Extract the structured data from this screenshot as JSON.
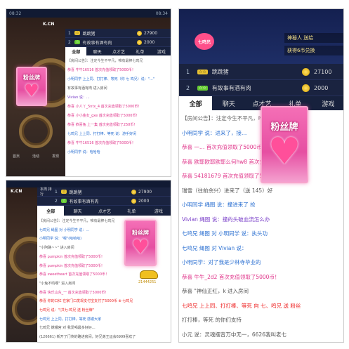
{
  "panel1": {
    "status_left": "08:32",
    "status_right": "08:34",
    "logo": "K.CN",
    "rank_header": "本周 排行",
    "rank": [
      {
        "num": "1",
        "name": "跳跳猪",
        "score": "27900"
      },
      {
        "num": "2",
        "name": "有故事有酒有肉",
        "score": "2000"
      }
    ],
    "tabs": [
      "全部",
      "聊天",
      "点才艺",
      "礼单",
      "游戏"
    ],
    "lines": [
      "【房间公告】：注定今生不平凡，唯有最棒七鸣兄",
      "恭喜 牛牛16516 首次充值领取了5000币！",
      "小明同学 上上同、打打棒、等死（你 七 鸣兄）说：\"...\"",
      "有故事有酒有肉 进入房间",
      "Vivian 说：...",
      "恭喜 小人丫_5ntx_4 首次充值领取了5000币！",
      "恭喜 小小金女_gxe 首次充值领取了5000币！",
      "恭喜 恭喜兔 上一集 首次充值领取了250币！",
      "七鸣兄 上上同、打打棒、等死 说：游手好闲",
      "恭喜 牛牛16516 首次充值领取了5000币！",
      "小明同学 说：哈哈哈"
    ],
    "card_title": "粉丝牌",
    "heart_glyph": "♥",
    "side_tabs": [
      "首页",
      "活动",
      "发现"
    ]
  },
  "panel2": {
    "badge": "七鸣兄",
    "marquee": "神秘人 送给",
    "marquee2": "获得6币兑换",
    "rank": [
      {
        "num": "1",
        "name": "跳跳猪",
        "score": "27100"
      },
      {
        "num": "2",
        "name": "有故事有酒有肉",
        "score": "2000"
      }
    ],
    "tabs": [
      "全部",
      "聊天",
      "点才艺",
      "礼单",
      "游戏"
    ],
    "lines": [
      {
        "text": "【房间公告】：注定今生不平凡，唯有最",
        "cls": "sys"
      },
      {
        "text": "小明同学 说：进来了，接…",
        "cls": "blue"
      },
      {
        "text": "恭喜 一…  首次充值领取了5000币！",
        "cls": "pink"
      },
      {
        "text": "恭喜 欧耶欧耶欧耶么何hw8 首次充值领取了5000币！",
        "cls": "pink"
      },
      {
        "text": "恭喜 54181679 首次充值领取了5000币！",
        "cls": "pink"
      },
      {
        "text": "瑞雪（往前余兴）进来了（送 145）好",
        "cls": "gray"
      },
      {
        "text": "小明同学 绳图 说：撞进来了 抢",
        "cls": "blue"
      },
      {
        "text": "Vivian 绳图 说：撞的头破血流怎么办",
        "cls": "purple"
      },
      {
        "text": "七鸣兄 绳图 对 小明同学 说：执头功",
        "cls": "blue"
      },
      {
        "text": "七鸣兄 绳图 对 Vivian 说：",
        "cls": "blue"
      },
      {
        "text": "小明同学：对了我是少林寺毕业的",
        "cls": "blue"
      },
      {
        "text": "恭喜 牛牛_2d2 首次充值领取了5000币！",
        "cls": "pink"
      },
      {
        "text": "恭喜 \"神仙正红，k 进入房间",
        "cls": "gray"
      },
      {
        "text": "七鸣兄 上上同、打打棒、等死 向 七、鸣兄 送 粉丝",
        "cls": "red"
      },
      {
        "text": "打打棒，等死 的你们支持",
        "cls": "gray"
      },
      {
        "text": "小元 说：灵魂摆音万中无一，6626我叫老七",
        "cls": "gray"
      }
    ],
    "card_title": "粉丝牌",
    "heart_glyph": "♥"
  },
  "panel3": {
    "logo": "K.CN",
    "rank_header": "本周 排行",
    "rank": [
      {
        "num": "1",
        "name": "跳跳猪",
        "score": "27900"
      },
      {
        "num": "2",
        "name": "有故事有酒有肉",
        "score": "2000"
      }
    ],
    "tabs": [
      "全部",
      "聊天",
      "点才艺",
      "礼单",
      "游戏"
    ],
    "lines": [
      {
        "text": "【房间公告】：注定今生不平凡，唯有最棒七鸣兄",
        "cls": "sys"
      },
      {
        "text": "七鸣兄 绳图 对 小明同学 说：…",
        "cls": "blue"
      },
      {
        "text": "小明同学 说：\"嗯\"(哈哈哈)",
        "cls": "blue"
      },
      {
        "text": "\"小阿路~~\" 进入房间",
        "cls": "gray"
      },
      {
        "text": "恭喜 pumpkin 首次充值领取了5000币！",
        "cls": "pink"
      },
      {
        "text": "恭喜 pumpkin 首次充值领取了5000币！",
        "cls": "pink"
      },
      {
        "text": "恭喜 sweetheart 首次充值领取了5000币！",
        "cls": "pink"
      },
      {
        "text": "\"小兔不鸣嘤\" 进入房间",
        "cls": "gray"
      },
      {
        "text": "恭喜 快乐山东_一 首次充值领取了5000币！",
        "cls": "pink"
      },
      {
        "text": "恭喜 你的口红 在家门口发现支付宝支付了5000币 ⊕ 七鸣兄",
        "cls": "red"
      },
      {
        "text": "七鸣兄 说：\"(共七·鸣兄 送 粉丝牌\"",
        "cls": "red"
      },
      {
        "text": "七鸣兄 上上同，打打棒，等死 感谢大家",
        "cls": "blue"
      },
      {
        "text": "七鸣兄 嫦娥宫 对 我爱喝最多好好…",
        "cls": "gray"
      },
      {
        "text": "(126661) 新开了门传的路进房间，好兄弟王运会6999喜欢了",
        "cls": "gray"
      }
    ],
    "card_title": "粉丝牌",
    "heart_glyph": "♥",
    "car_value": "21444251"
  },
  "colors": {
    "brand_pink": "#e64fa2",
    "dark_nav": "#17213d",
    "notice_pink": "#e0348a"
  }
}
